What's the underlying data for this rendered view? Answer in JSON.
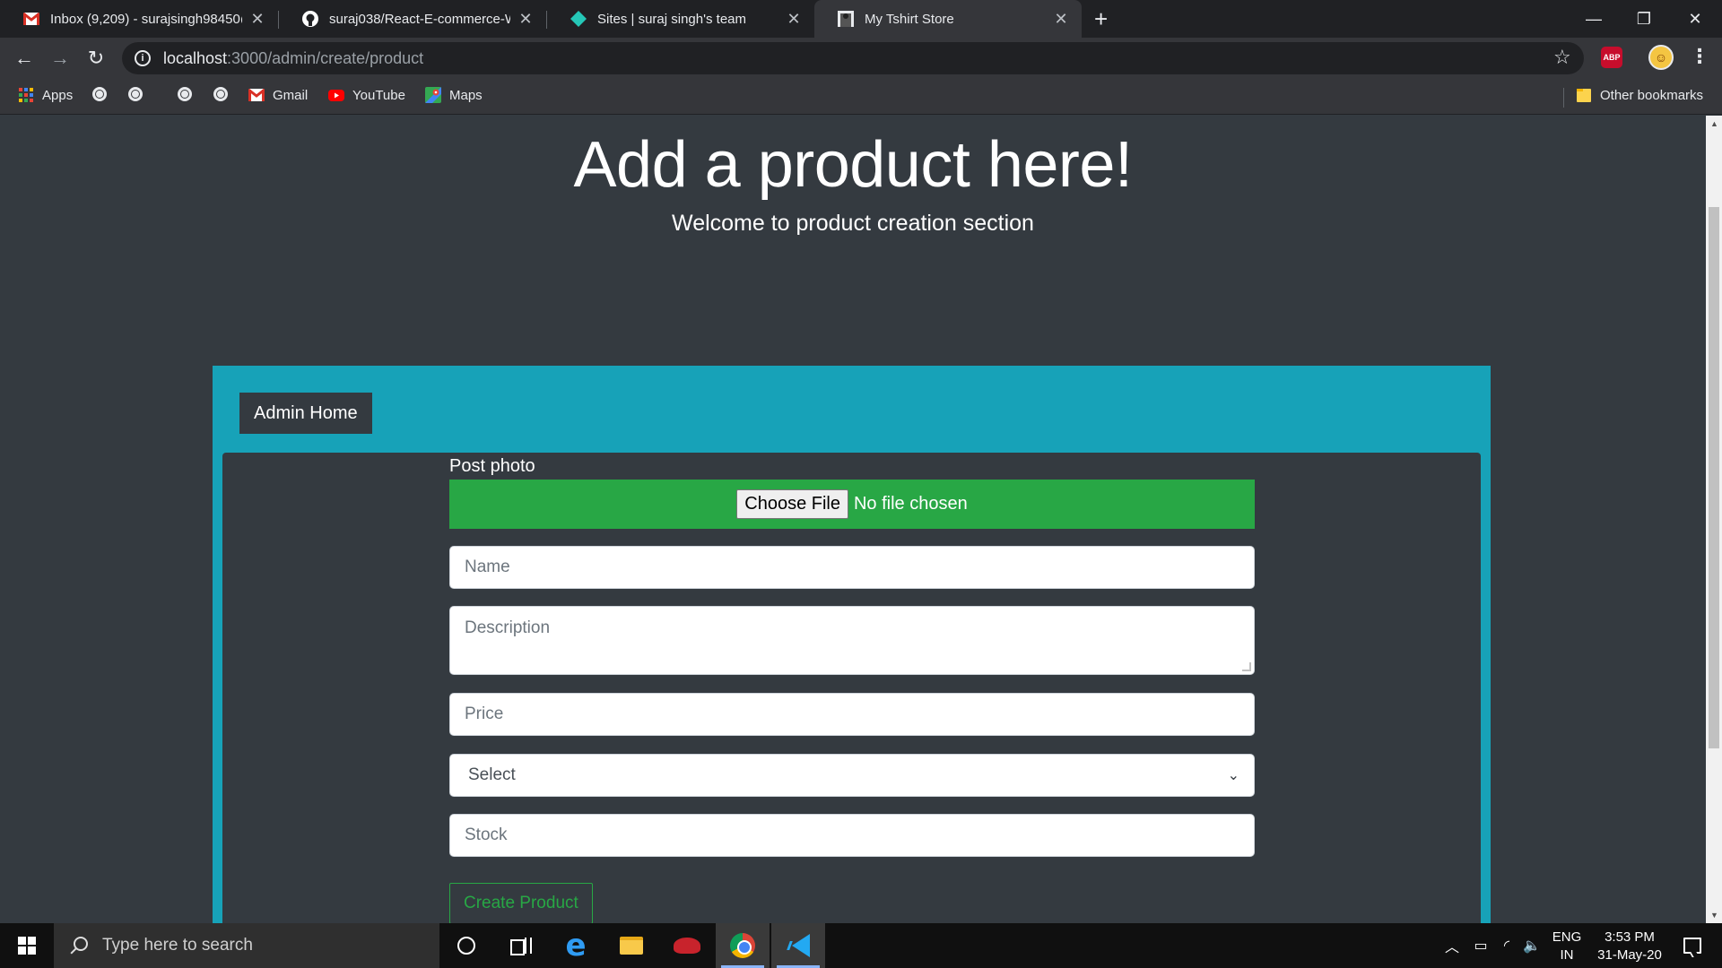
{
  "browser": {
    "tabs": [
      {
        "title": "Inbox (9,209) - surajsingh98450@",
        "icon": "gmail-icon"
      },
      {
        "title": "suraj038/React-E-commerce-Wel",
        "icon": "github-icon"
      },
      {
        "title": "Sites | suraj singh's team",
        "icon": "netlify-icon"
      },
      {
        "title": "My Tshirt Store",
        "icon": "store-icon",
        "active": true
      }
    ],
    "new_tab": "+",
    "url_host": "localhost",
    "url_path": ":3000/admin/create/product",
    "bookmarks": {
      "apps": "Apps",
      "gmail": "Gmail",
      "youtube": "YouTube",
      "maps": "Maps",
      "other": "Other bookmarks"
    },
    "extension_abp": "ABP"
  },
  "page": {
    "title": "Add a product here!",
    "subtitle": "Welcome to product creation section",
    "admin_home_label": "Admin Home",
    "post_photo_label": "Post photo",
    "choose_file_label": "Choose File",
    "no_file_label": "No file chosen",
    "name_placeholder": "Name",
    "description_placeholder": "Description",
    "price_placeholder": "Price",
    "category_selected": "Select",
    "stock_placeholder": "Stock",
    "create_button_label": "Create Product",
    "colors": {
      "background": "#343a40",
      "info_panel": "#17a2b8",
      "file_area": "#28a745",
      "create_button": "#28a745"
    }
  },
  "taskbar": {
    "search_placeholder": "Type here to search",
    "lang_top": "ENG",
    "lang_bottom": "IN",
    "time": "3:53 PM",
    "date": "31-May-20"
  }
}
